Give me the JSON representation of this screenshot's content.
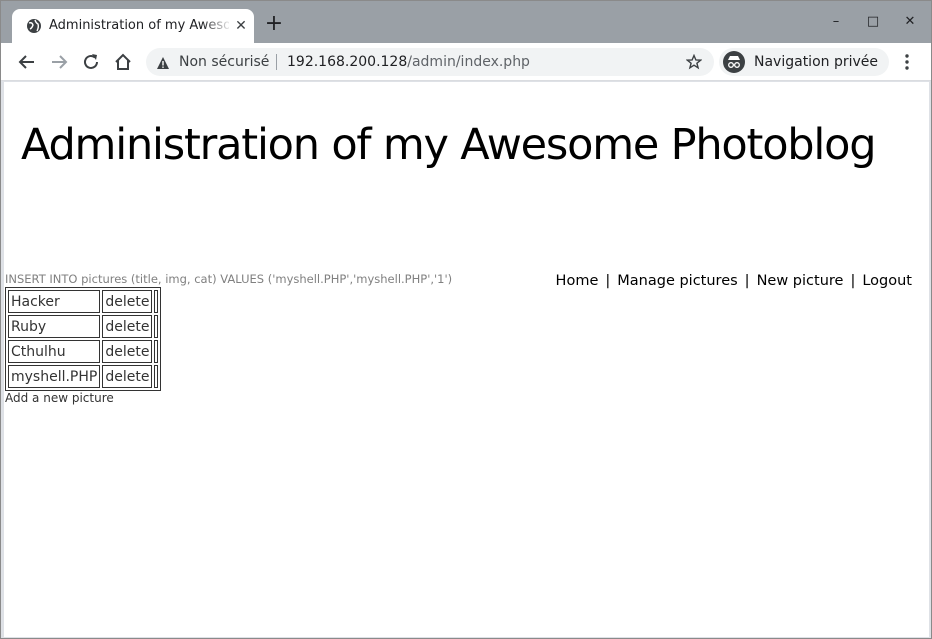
{
  "browser": {
    "tab": {
      "title": "Administration of my Awesome Photoblog"
    },
    "window_controls": {
      "minimize": "–",
      "maximize": "□",
      "close": "✕"
    },
    "omnibox": {
      "security_label": "Non sécurisé",
      "url_host": "192.168.200.128",
      "url_path": "/admin/index.php"
    },
    "incognito_label": "Navigation privée"
  },
  "page": {
    "title": "Administration of my Awesome Photoblog",
    "sql_message": "INSERT INTO pictures (title, img, cat) VALUES ('myshell.PHP','myshell.PHP','1')",
    "nav": [
      "Home",
      "Manage pictures",
      "New picture",
      "Logout"
    ],
    "nav_separator": "|",
    "pictures": [
      {
        "title": "Hacker",
        "action": "delete"
      },
      {
        "title": "Ruby",
        "action": "delete"
      },
      {
        "title": "Cthulhu",
        "action": "delete"
      },
      {
        "title": "myshell.PHP",
        "action": "delete"
      }
    ],
    "add_link": "Add a new picture"
  }
}
